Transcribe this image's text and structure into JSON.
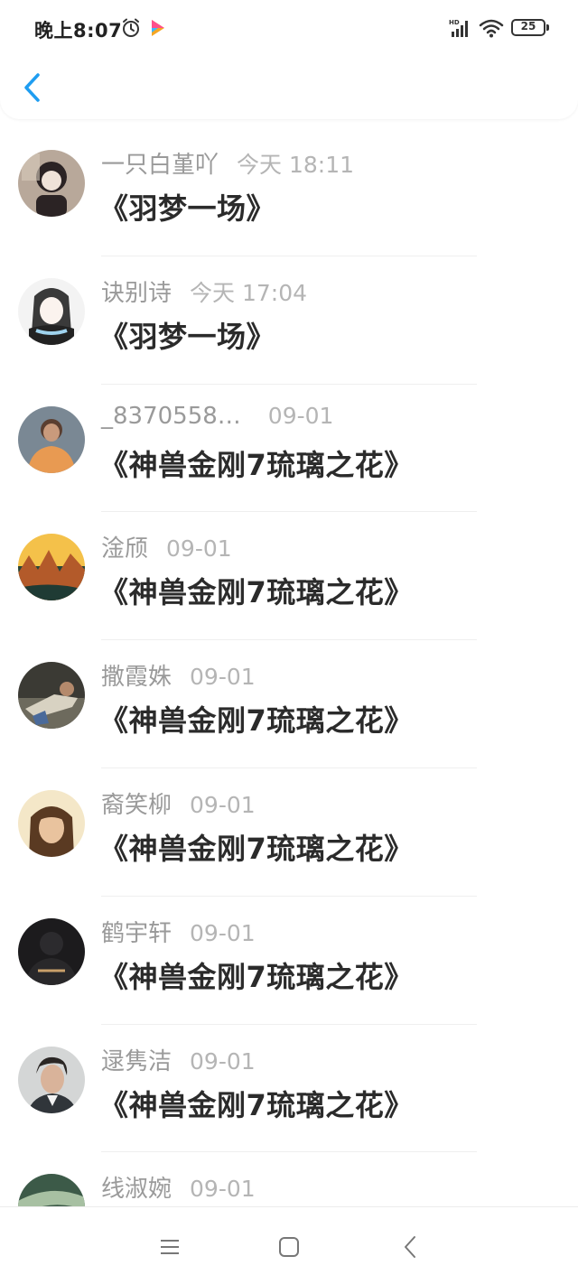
{
  "status_bar": {
    "time": "晚上8:07",
    "battery": "25",
    "icons": [
      "alarm-icon",
      "video-play-icon",
      "hd-signal-icon",
      "wifi-icon",
      "battery-icon"
    ]
  },
  "header": {
    "back_icon": "chevron-left-icon",
    "accent_color": "#1e9df1"
  },
  "list": [
    {
      "name": "一只白堇吖",
      "time": "今天 18:11",
      "title": "《羽梦一场》"
    },
    {
      "name": "诀别诗",
      "time": "今天 17:04",
      "title": "《羽梦一场》"
    },
    {
      "name": "_8370558…",
      "time": "09-01",
      "title": "《神兽金刚7琉璃之花》"
    },
    {
      "name": "淦颀",
      "time": "09-01",
      "title": "《神兽金刚7琉璃之花》"
    },
    {
      "name": "撒霞姝",
      "time": "09-01",
      "title": "《神兽金刚7琉璃之花》"
    },
    {
      "name": "裔笑柳",
      "time": "09-01",
      "title": "《神兽金刚7琉璃之花》"
    },
    {
      "name": "鹤宇轩",
      "time": "09-01",
      "title": "《神兽金刚7琉璃之花》"
    },
    {
      "name": "逯隽洁",
      "time": "09-01",
      "title": "《神兽金刚7琉璃之花》"
    },
    {
      "name": "线淑婉",
      "time": "09-01",
      "title": ""
    }
  ],
  "nav_bar": {
    "icons": [
      "menu-icon",
      "home-square-icon",
      "back-triangle-icon"
    ]
  }
}
